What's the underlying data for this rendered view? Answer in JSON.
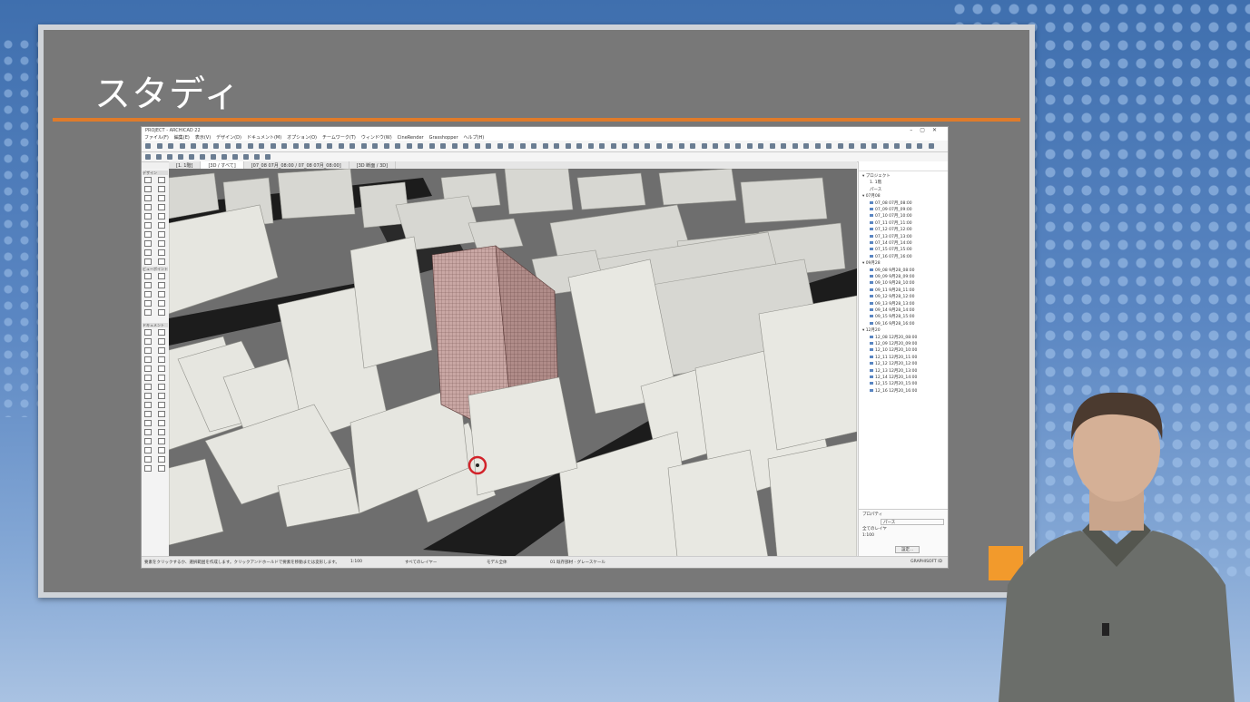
{
  "slide": {
    "title": "スタディ"
  },
  "app": {
    "window_title": "PROJECT - ARCHICAD 22",
    "menu": [
      "ファイル(F)",
      "編集(E)",
      "表示(V)",
      "デザイン(D)",
      "ドキュメント(M)",
      "オプション(O)",
      "チームワーク(T)",
      "ウィンドウ(W)",
      "CineRender",
      "Grasshopper",
      "ヘルプ(H)"
    ],
    "tabs": [
      "[1. 1階]",
      "[3D / すべて]",
      "[07_08 07月_08:00 / 07_08 07月_08:00]",
      "[3D 断面 / 3D]"
    ],
    "active_tab_index": 1,
    "left_palette": {
      "sections": [
        "デザイン",
        "ビューポイント",
        "ドキュメント"
      ]
    },
    "right_panel": {
      "tree": [
        {
          "label": "プロジェクト",
          "level": 0
        },
        {
          "label": "1. 1階",
          "level": 1
        },
        {
          "label": "パース",
          "level": 1
        },
        {
          "label": "07月08",
          "level": 0
        },
        {
          "label": "07_08 07月_08:00",
          "level": 2
        },
        {
          "label": "07_09 07月_09:00",
          "level": 2
        },
        {
          "label": "07_10 07月_10:00",
          "level": 2
        },
        {
          "label": "07_11 07月_11:00",
          "level": 2
        },
        {
          "label": "07_12 07月_12:00",
          "level": 2
        },
        {
          "label": "07_13 07月_13:00",
          "level": 2
        },
        {
          "label": "07_14 07月_14:00",
          "level": 2
        },
        {
          "label": "07_15 07月_15:00",
          "level": 2
        },
        {
          "label": "07_16 07月_16:00",
          "level": 2
        },
        {
          "label": "09月28",
          "level": 0
        },
        {
          "label": "09_08 9月28_08:00",
          "level": 2
        },
        {
          "label": "09_09 9月28_09:00",
          "level": 2
        },
        {
          "label": "09_10 9月28_10:00",
          "level": 2
        },
        {
          "label": "09_11 9月28_11:00",
          "level": 2
        },
        {
          "label": "09_12 9月28_12:00",
          "level": 2
        },
        {
          "label": "09_13 9月28_13:00",
          "level": 2
        },
        {
          "label": "09_14 9月28_14:00",
          "level": 2
        },
        {
          "label": "09_15 9月28_15:00",
          "level": 2
        },
        {
          "label": "09_16 9月28_16:00",
          "level": 2
        },
        {
          "label": "12月20",
          "level": 0
        },
        {
          "label": "12_08 12月20_08:00",
          "level": 2
        },
        {
          "label": "12_09 12月20_09:00",
          "level": 2
        },
        {
          "label": "12_10 12月20_10:00",
          "level": 2
        },
        {
          "label": "12_11 12月20_11:00",
          "level": 2
        },
        {
          "label": "12_12 12月20_12:00",
          "level": 2
        },
        {
          "label": "12_13 12月20_13:00",
          "level": 2
        },
        {
          "label": "12_14 12月20_14:00",
          "level": 2
        },
        {
          "label": "12_15 12月20_15:00",
          "level": 2
        },
        {
          "label": "12_16 12月20_16:00",
          "level": 2
        }
      ],
      "properties_header": "プロパティ",
      "prop_name": "パース",
      "prop_scale": "1:100",
      "prop_layer": "全てのレイヤ",
      "settings_button": "設定..."
    },
    "statusbar": {
      "hint": "要素をクリックするか、選択範囲を作成します。クリックアンドホールドで要素を移動または変形します。",
      "scale": "1:100",
      "layer": "すべてのレイヤー",
      "model": "モデル全体",
      "pen": "01 既存部材 - グレースケール",
      "status": "GRAPHISOFT ID"
    }
  },
  "colors": {
    "slide_bg": "#787878",
    "accent_rule": "#e07b2a",
    "background_blue": "#4a79b8"
  }
}
